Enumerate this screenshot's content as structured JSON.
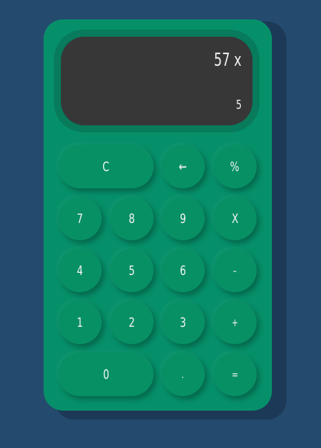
{
  "display": {
    "expression": "57 x",
    "current": "5"
  },
  "keys": {
    "clear": "C",
    "backspace": "⇜",
    "percent": "%",
    "seven": "7",
    "eight": "8",
    "nine": "9",
    "multiply": "X",
    "four": "4",
    "five": "5",
    "six": "6",
    "minus": "–",
    "one": "1",
    "two": "2",
    "three": "3",
    "plus": "+",
    "zero": "0",
    "decimal": ".",
    "equals": "="
  },
  "colors": {
    "background": "#244a6d",
    "body": "#06906a",
    "screen": "#373737"
  }
}
